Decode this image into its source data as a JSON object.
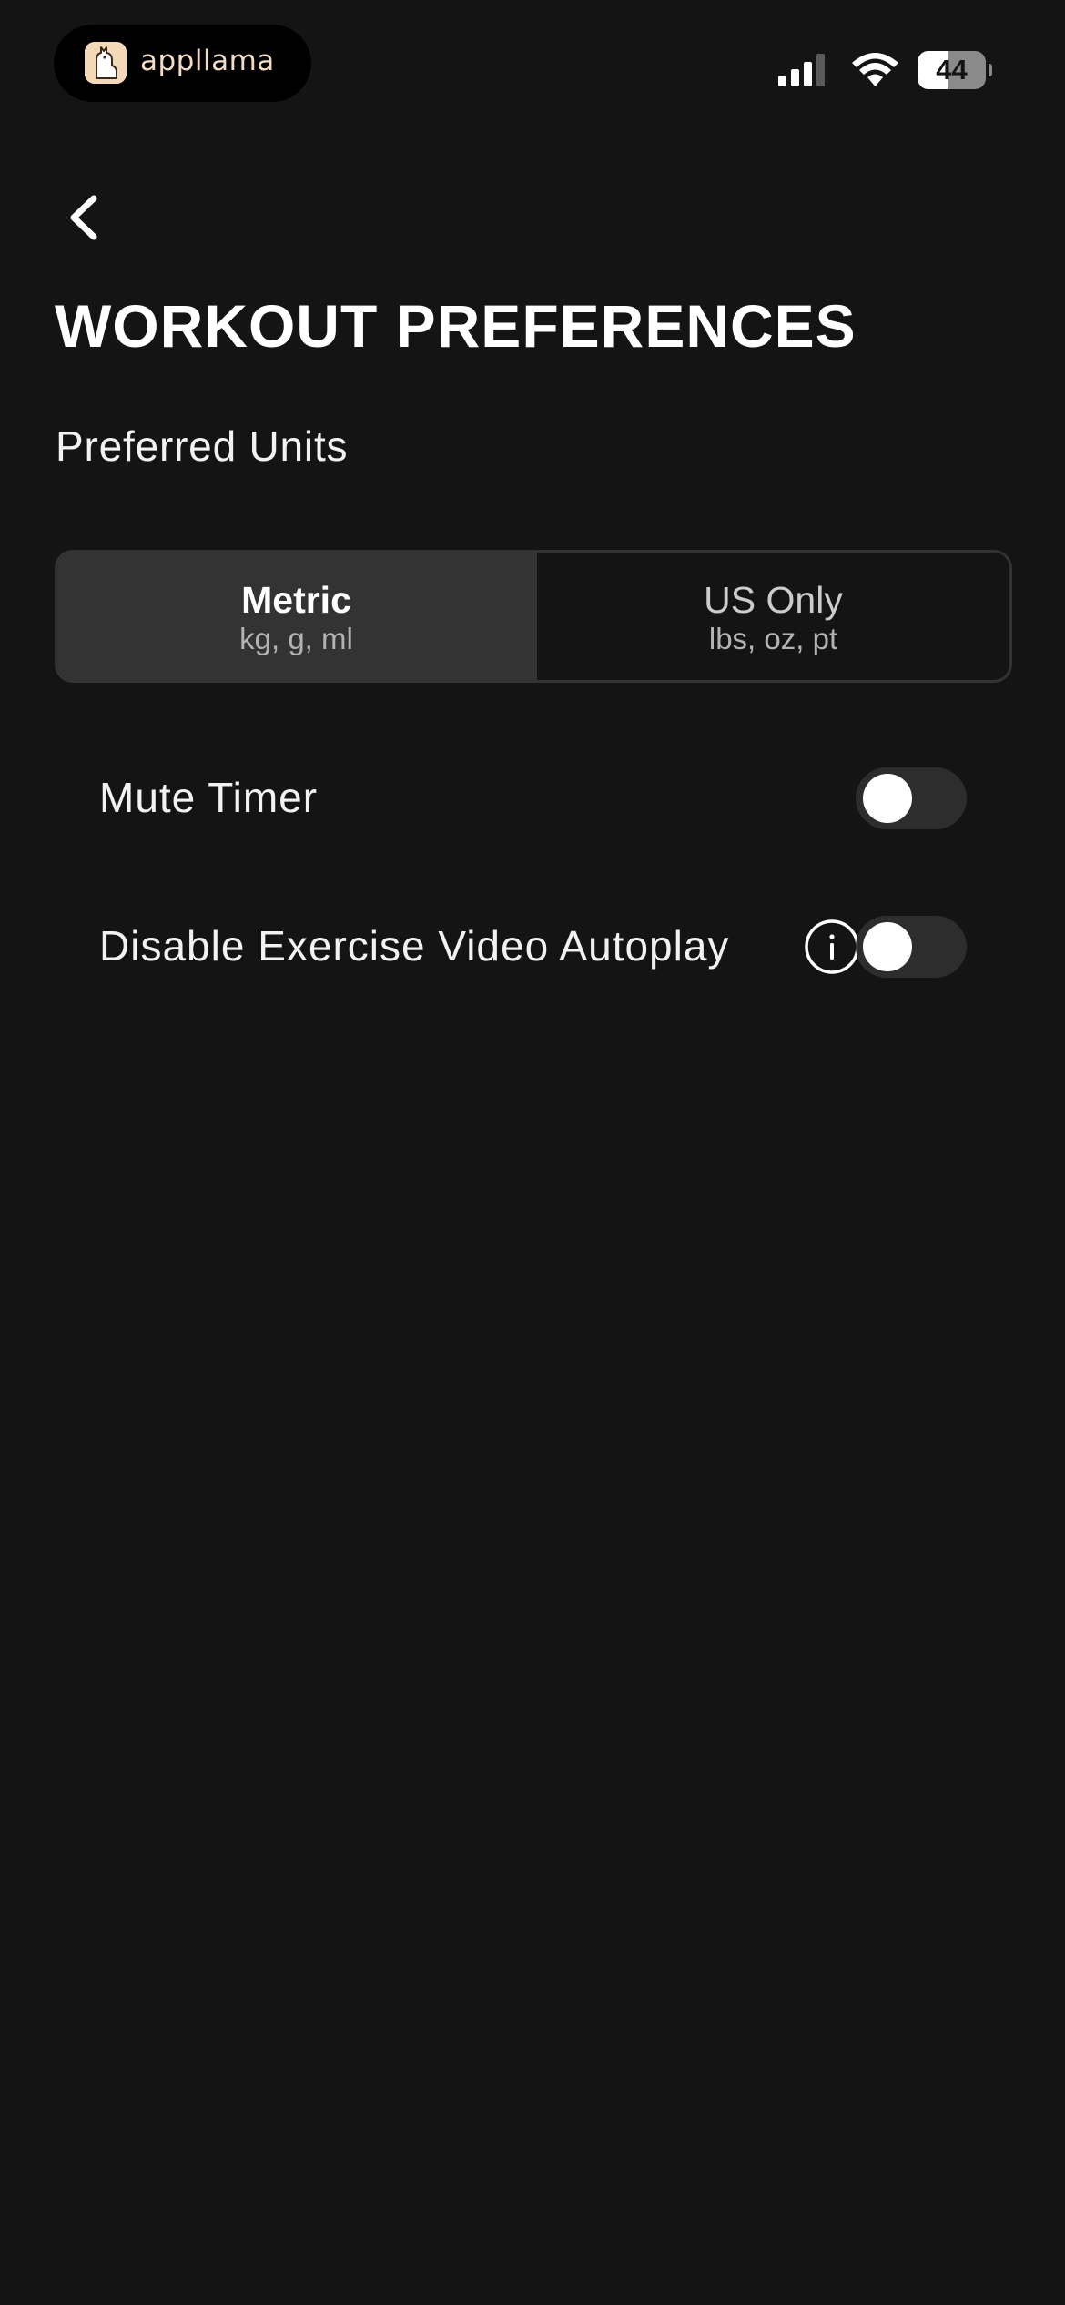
{
  "status_bar": {
    "app_name": "appllama",
    "battery_level": "44",
    "battery_fraction": 0.44,
    "icons": [
      "signal-icon",
      "wifi-icon",
      "battery-icon"
    ]
  },
  "header": {
    "back_icon": "chevron-left-icon",
    "title": "WORKOUT PREFERENCES"
  },
  "units": {
    "label": "Preferred Units",
    "selected": "Metric",
    "options": [
      {
        "title": "Metric",
        "subtitle": "kg, g, ml"
      },
      {
        "title": "US Only",
        "subtitle": "lbs, oz, pt"
      }
    ]
  },
  "settings": [
    {
      "label": "Mute Timer",
      "enabled": false
    },
    {
      "label": "Disable Exercise Video Autoplay",
      "enabled": false,
      "info_icon": "info-icon"
    }
  ],
  "colors": {
    "background": "#141414",
    "selected_segment": "#333333",
    "toggle_off": "#2d2d2d",
    "text": "#ffffff",
    "brand": "#f1dcc6"
  }
}
